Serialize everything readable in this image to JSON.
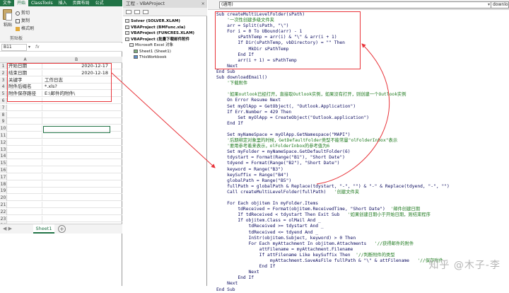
{
  "excel": {
    "tabs": [
      "文件",
      "开始",
      "ClassTools",
      "插入",
      "页面布局",
      "公式"
    ],
    "ribbon": {
      "cut": "剪切",
      "copy": "复制",
      "paste": "粘贴",
      "format_painter": "格式刷",
      "clipboard_group": "剪贴板"
    },
    "name_box": "B11",
    "fx_label": "fx",
    "columns": [
      "A",
      "B"
    ],
    "rows": [
      {
        "num": "1",
        "a": "开始日期",
        "b": "2020-12-17",
        "b_numeric": true
      },
      {
        "num": "2",
        "a": "结束日期",
        "b": "2020-12-18",
        "b_numeric": true
      },
      {
        "num": "3",
        "a": "关键字",
        "b": "工作日志",
        "b_numeric": false
      },
      {
        "num": "4",
        "a": "附件后缀名",
        "b": "*.xls?",
        "b_numeric": false
      },
      {
        "num": "5",
        "a": "附件保存路径",
        "b": "E:\\邮件的附件\\",
        "b_numeric": false
      },
      {
        "num": "6",
        "a": "",
        "b": "",
        "b_numeric": false
      },
      {
        "num": "7",
        "a": "",
        "b": "",
        "b_numeric": false
      },
      {
        "num": "8",
        "a": "",
        "b": "",
        "b_numeric": false
      },
      {
        "num": "9",
        "a": "",
        "b": "",
        "b_numeric": false
      },
      {
        "num": "10",
        "a": "",
        "b": "",
        "b_numeric": false
      },
      {
        "num": "11",
        "a": "",
        "b": "",
        "b_numeric": false
      },
      {
        "num": "12",
        "a": "",
        "b": "",
        "b_numeric": false
      },
      {
        "num": "13",
        "a": "",
        "b": "",
        "b_numeric": false
      },
      {
        "num": "14",
        "a": "",
        "b": "",
        "b_numeric": false
      },
      {
        "num": "15",
        "a": "",
        "b": "",
        "b_numeric": false
      },
      {
        "num": "16",
        "a": "",
        "b": "",
        "b_numeric": false
      },
      {
        "num": "17",
        "a": "",
        "b": "",
        "b_numeric": false
      },
      {
        "num": "18",
        "a": "",
        "b": "",
        "b_numeric": false
      },
      {
        "num": "19",
        "a": "",
        "b": "",
        "b_numeric": false
      },
      {
        "num": "20",
        "a": "",
        "b": "",
        "b_numeric": false
      },
      {
        "num": "21",
        "a": "",
        "b": "",
        "b_numeric": false
      },
      {
        "num": "22",
        "a": "",
        "b": "",
        "b_numeric": false
      },
      {
        "num": "23",
        "a": "",
        "b": "",
        "b_numeric": false
      },
      {
        "num": "24",
        "a": "",
        "b": "",
        "b_numeric": false
      }
    ],
    "sheet_tab": "Sheet1",
    "add_sheet": "+",
    "sheet_nav": "◀ ▶"
  },
  "project": {
    "title": "工程 - VBAProject",
    "close": "×",
    "tree": [
      {
        "label": "Solver (SOLVER.XLAM)",
        "bold": true,
        "icon": "project"
      },
      {
        "label": "VBAProject (BMFunc.xla)",
        "bold": true,
        "icon": "project"
      },
      {
        "label": "VBAProject (FUNCRES.XLAM)",
        "bold": true,
        "icon": "project"
      },
      {
        "label": "VBAProject (批量下载邮件附件",
        "bold": true,
        "icon": "project"
      },
      {
        "label": "Microsoft Excel 对象",
        "bold": false,
        "icon": "folder"
      },
      {
        "label": "Sheet1 (Sheet1)",
        "bold": false,
        "icon": "worksheet"
      },
      {
        "label": "ThisWorkbook",
        "bold": false,
        "icon": "workbook"
      }
    ]
  },
  "code": {
    "combo_object": "(通用)",
    "combo_proc": "downloa",
    "lines": [
      {
        "t": "Sub createMultiLevelFolder(sPath)",
        "c": false
      },
      {
        "t": "    '一次性创建多级文件夹",
        "c": true
      },
      {
        "t": "    arr = Split(sPath, \"\\\")",
        "c": false
      },
      {
        "t": "    For i = 0 To UBound(arr) - 1",
        "c": false
      },
      {
        "t": "        sPathTemp = arr(i) & \"\\\" & arr(i + 1)",
        "c": false
      },
      {
        "t": "        If Dir(sPathTemp, vbDirectory) = \"\" Then",
        "c": false
      },
      {
        "t": "            MkDir sPathTemp",
        "c": false
      },
      {
        "t": "        End If",
        "c": false
      },
      {
        "t": "        arr(i + 1) = sPathTemp",
        "c": false
      },
      {
        "t": "    Next",
        "c": false
      },
      {
        "t": "End Sub",
        "c": false
      },
      {
        "t": "Sub downloadEmail()",
        "c": false
      },
      {
        "t": "    '下载附件",
        "c": true
      },
      {
        "t": "",
        "c": false
      },
      {
        "t": "    '如果outlook已经打开，直接取Outlook实例，如果没有打开，则创建一个Outlook实例",
        "c": true
      },
      {
        "t": "    On Error Resume Next",
        "c": false
      },
      {
        "t": "    Set myOlApp = GetObject(, \"Outlook.Application\")",
        "c": false
      },
      {
        "t": "    If Err.Number = 429 Then",
        "c": false
      },
      {
        "t": "        Set myOlApp = CreateObject(\"Outlook.application\")",
        "c": false
      },
      {
        "t": "    End If",
        "c": false
      },
      {
        "t": "",
        "c": false
      },
      {
        "t": "    Set myNameSpace = myOlApp.GetNamespace(\"MAPI\")",
        "c": false
      },
      {
        "t": "    '后期绑定对象里的时候，GetDefaultFolder类型不能常量\"olFolderInbox\"表示",
        "c": true
      },
      {
        "t": "    '要用参考着来表示，olFolderInbox的参考值为6",
        "c": true
      },
      {
        "t": "    Set myFolder = myNameSpace.GetDefaultFolder(6)",
        "c": false
      },
      {
        "t": "    tdystart = Format(Range(\"B1\"), \"Short Date\")",
        "c": false
      },
      {
        "t": "    tdyend = Format(Range(\"B2\"), \"Short Date\")",
        "c": false
      },
      {
        "t": "    keyword = Range(\"B3\")",
        "c": false
      },
      {
        "t": "    keySuffix = Range(\"B4\")",
        "c": false
      },
      {
        "t": "    globalPath = Range(\"B5\")",
        "c": false
      },
      {
        "t": "    fullPath = globalPath & Replace(tdystart, \"-\", \"\") & \"-\" & Replace(tdyend, \"-\", \"\")",
        "c": false
      },
      {
        "t": "    Call createMultiLevelFolder(fullPath)   '创建文件夹",
        "c": false,
        "split": true,
        "code": "    Call createMultiLevelFolder(fullPath)   ",
        "comment": "'创建文件夹"
      },
      {
        "t": "",
        "c": false
      },
      {
        "t": "    For Each objitem In myFolder.Items",
        "c": false
      },
      {
        "t": "        tdReceived = Format(objitem.ReceivedTime, \"Short Date\")  '邮件创建日期",
        "c": false,
        "split": true,
        "code": "        tdReceived = Format(objitem.ReceivedTime, \"Short Date\")  ",
        "comment": "'邮件创建日期"
      },
      {
        "t": "        If tdReceived < tdystart Then Exit Sub   '如果创建日期小于开始日期，则结束程序",
        "c": false,
        "split": true,
        "code": "        If tdReceived < tdystart Then Exit Sub   ",
        "comment": "'如果创建日期小于开始日期，则结束程序"
      },
      {
        "t": "        If objitem.Class = olMail And _",
        "c": false
      },
      {
        "t": "            tdReceived >= tdystart And _",
        "c": false
      },
      {
        "t": "            tdReceived <= tdyend And _",
        "c": false
      },
      {
        "t": "            InStr(objitem.Subject, keyword) > 0 Then",
        "c": false
      },
      {
        "t": "            For Each myAttachment In objitem.Attachments   '//获得邮件的附件",
        "c": false,
        "split": true,
        "code": "            For Each myAttachment In objitem.Attachments   ",
        "comment": "'//获得邮件的附件"
      },
      {
        "t": "                attFilename = myAttachment.Filename",
        "c": false
      },
      {
        "t": "                If attFilename Like keySuffix Then  '//判断附件的类型",
        "c": false,
        "split": true,
        "code": "                If attFilename Like keySuffix Then  ",
        "comment": "'//判断附件的类型"
      },
      {
        "t": "                    myAttachment.SaveAsFile fullPath & \"\\\" & attFilename   '//保存附件",
        "c": false,
        "split": true,
        "code": "                    myAttachment.SaveAsFile fullPath & \"\\\" & attFilename   ",
        "comment": "'//保存附件"
      },
      {
        "t": "                End If",
        "c": false
      },
      {
        "t": "            Next",
        "c": false
      },
      {
        "t": "        End If",
        "c": false
      },
      {
        "t": "    Next",
        "c": false
      },
      {
        "t": "End Sub",
        "c": false
      }
    ]
  },
  "watermark": "知乎 @木子-李",
  "colors": {
    "excel_green": "#217346",
    "annotation_red": "#e8343a",
    "code_keyword": "#0b0b5e",
    "code_comment": "#1f7a1f"
  }
}
